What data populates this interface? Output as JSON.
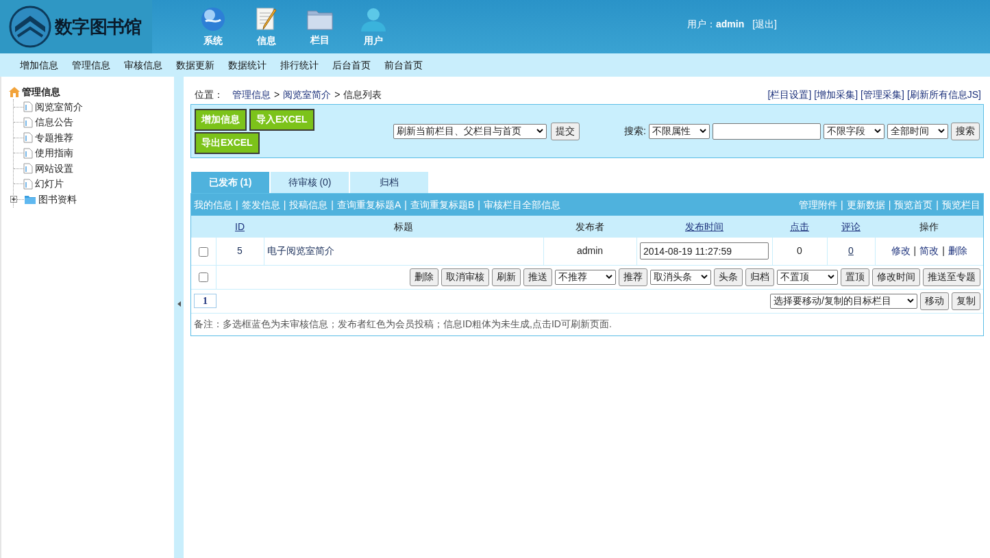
{
  "header": {
    "logo_text": "数字图书馆",
    "nav": [
      {
        "label": "系统",
        "kind": "globe"
      },
      {
        "label": "信息",
        "kind": "notepad"
      },
      {
        "label": "栏目",
        "kind": "folder"
      },
      {
        "label": "用户",
        "kind": "user"
      }
    ],
    "user_label": "用户：",
    "user_name": "admin",
    "logout": "[退出]"
  },
  "menu": [
    "增加信息",
    "管理信息",
    "审核信息",
    "数据更新",
    "数据统计",
    "排行统计",
    "后台首页",
    "前台首页"
  ],
  "sidebar": {
    "root": "管理信息",
    "items": [
      {
        "label": "阅览室简介",
        "kind": "page"
      },
      {
        "label": "信息公告",
        "kind": "page"
      },
      {
        "label": "专题推荐",
        "kind": "page"
      },
      {
        "label": "使用指南",
        "kind": "page"
      },
      {
        "label": "网站设置",
        "kind": "page"
      },
      {
        "label": "幻灯片",
        "kind": "page"
      },
      {
        "label": "图书资料",
        "kind": "folder",
        "expanded": false
      }
    ]
  },
  "breadcrumb": {
    "prefix": "位置：",
    "separator": ">",
    "items": [
      "管理信息",
      "阅览室简介"
    ],
    "current": "信息列表"
  },
  "top_links": [
    "[栏目设置]",
    "[增加采集]",
    "[管理采集]",
    "[刷新所有信息JS]"
  ],
  "toolbar": {
    "buttons": [
      "增加信息",
      "导入EXCEL",
      "导出EXCEL"
    ],
    "refresh_select": "刷新当前栏目、父栏目与首页",
    "submit": "提交",
    "search_label": "搜索:",
    "attr_select": "不限属性",
    "field_select": "不限字段",
    "time_select": "全部时间",
    "search_button": "搜索"
  },
  "tabs": [
    {
      "label": "已发布 (1)",
      "selected": true
    },
    {
      "label": "待审核 (0)",
      "selected": false
    },
    {
      "label": "归档",
      "selected": false
    }
  ],
  "links_separator": "|",
  "links_left": [
    "我的信息",
    "签发信息",
    "投稿信息",
    "查询重复标题A",
    "查询重复标题B",
    "审核栏目全部信息"
  ],
  "links_right": [
    "管理附件",
    "更新数据",
    "预览首页",
    "预览栏目"
  ],
  "columns": [
    {
      "label": "ID",
      "sortable": true
    },
    {
      "label": "标题",
      "sortable": false
    },
    {
      "label": "发布者",
      "sortable": false
    },
    {
      "label": "发布时间",
      "sortable": true
    },
    {
      "label": "点击",
      "sortable": true
    },
    {
      "label": "评论",
      "sortable": true
    },
    {
      "label": "操作",
      "sortable": false
    }
  ],
  "rows": [
    {
      "checked": false,
      "id": "5",
      "title": "电子阅览室简介",
      "author": "admin",
      "time": "2014-08-19 11:27:59",
      "clicks": "0",
      "comments": "0",
      "actions": [
        "修改",
        "简改",
        "删除"
      ]
    }
  ],
  "batch": {
    "checked": false,
    "controls": [
      {
        "kind": "button",
        "label": "删除"
      },
      {
        "kind": "button",
        "label": "取消审核"
      },
      {
        "kind": "button",
        "label": "刷新"
      },
      {
        "kind": "button",
        "label": "推送"
      },
      {
        "kind": "select",
        "label": "不推荐"
      },
      {
        "kind": "button",
        "label": "推荐"
      },
      {
        "kind": "select",
        "label": "取消头条"
      },
      {
        "kind": "button",
        "label": "头条"
      },
      {
        "kind": "button",
        "label": "归档"
      },
      {
        "kind": "select",
        "label": "不置顶"
      },
      {
        "kind": "button",
        "label": "置顶"
      },
      {
        "kind": "button",
        "label": "修改时间"
      },
      {
        "kind": "button",
        "label": "推送至专题"
      }
    ]
  },
  "pagination": {
    "page": "1",
    "move_select": "选择要移动/复制的目标栏目",
    "buttons": [
      "移动",
      "复制"
    ]
  },
  "note": "备注：多选框蓝色为未审核信息；发布者红色为会员投稿；信息ID粗体为未生成,点击ID可刷新页面."
}
